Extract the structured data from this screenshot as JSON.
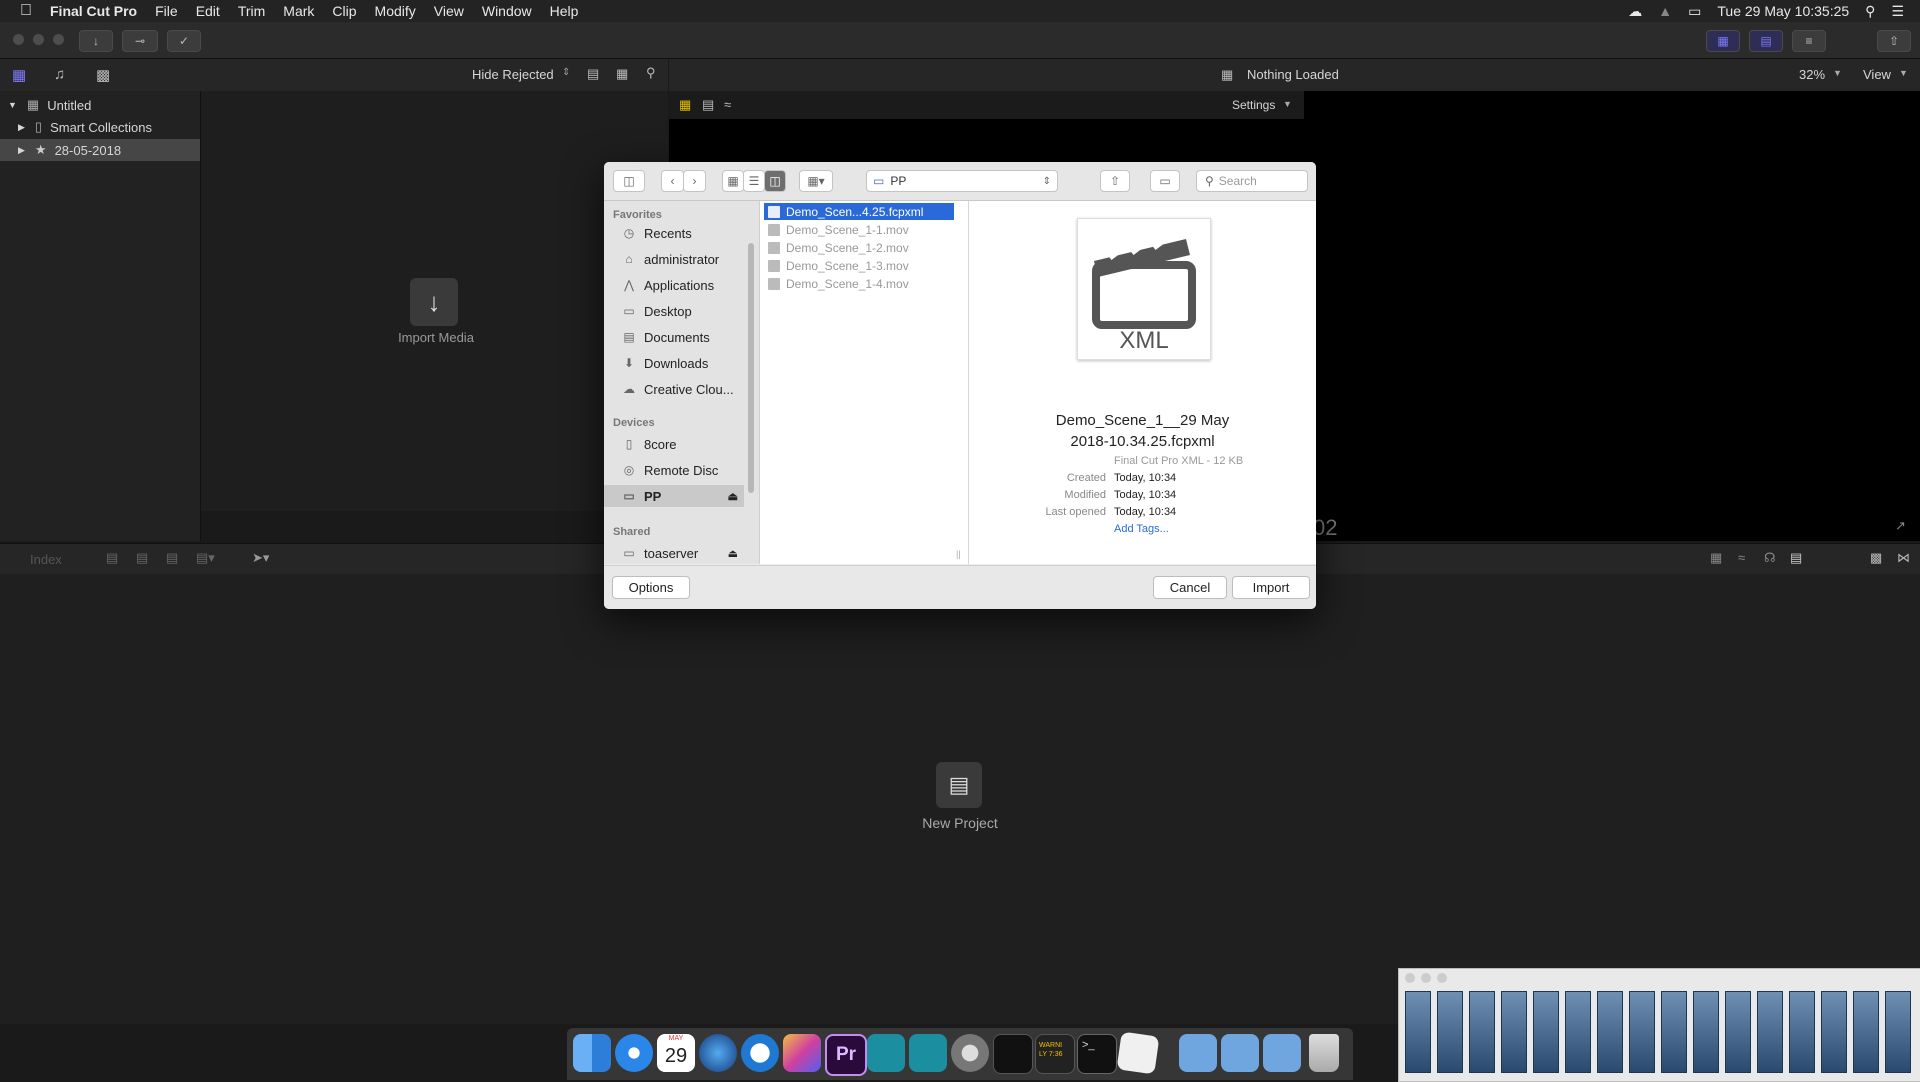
{
  "menubar": {
    "app_name": "Final Cut Pro",
    "menus": [
      "File",
      "Edit",
      "Trim",
      "Mark",
      "Clip",
      "Modify",
      "View",
      "Window",
      "Help"
    ],
    "clock": "Tue 29 May  10:35:25"
  },
  "libraries": {
    "filter_label": "Hide Rejected",
    "items": [
      {
        "label": "Untitled"
      },
      {
        "label": "Smart Collections"
      },
      {
        "label": "28-05-2018"
      }
    ],
    "import_label": "Import Media"
  },
  "viewer": {
    "status": "Nothing Loaded",
    "zoom": "32%",
    "view_menu": "View",
    "settings": "Settings",
    "timecode_fragment": "02"
  },
  "timeline": {
    "index_label": "Index",
    "new_project_label": "New Project"
  },
  "dialog": {
    "location": "PP",
    "search_placeholder": "Search",
    "sidebar": {
      "favorites_header": "Favorites",
      "favorites": [
        {
          "label": "Recents",
          "icon": "clock-icon"
        },
        {
          "label": "administrator",
          "icon": "home-icon"
        },
        {
          "label": "Applications",
          "icon": "applications-icon"
        },
        {
          "label": "Desktop",
          "icon": "desktop-icon"
        },
        {
          "label": "Documents",
          "icon": "documents-icon"
        },
        {
          "label": "Downloads",
          "icon": "downloads-icon"
        },
        {
          "label": "Creative Clou...",
          "icon": "creative-cloud-icon"
        }
      ],
      "devices_header": "Devices",
      "devices": [
        {
          "label": "8core",
          "icon": "drive-icon"
        },
        {
          "label": "Remote Disc",
          "icon": "disc-icon"
        },
        {
          "label": "PP",
          "icon": "drive-icon"
        }
      ],
      "shared_header": "Shared",
      "shared": [
        {
          "label": "toaserver",
          "icon": "server-icon"
        }
      ]
    },
    "files": [
      {
        "name": "Demo_Scen...4.25.fcpxml"
      },
      {
        "name": "Demo_Scene_1-1.mov"
      },
      {
        "name": "Demo_Scene_1-2.mov"
      },
      {
        "name": "Demo_Scene_1-3.mov"
      },
      {
        "name": "Demo_Scene_1-4.mov"
      }
    ],
    "preview": {
      "badge": "XML",
      "name_line1": "Demo_Scene_1__29 May",
      "name_line2": "2018-10.34.25.fcpxml",
      "kind": "Final Cut Pro XML - 12 KB",
      "created_label": "Created",
      "created_value": "Today, 10:34",
      "modified_label": "Modified",
      "modified_value": "Today, 10:34",
      "opened_label": "Last opened",
      "opened_value": "Today, 10:34",
      "add_tags": "Add Tags..."
    },
    "buttons": {
      "options": "Options",
      "cancel": "Cancel",
      "import": "Import"
    }
  },
  "dock": {
    "calendar_month": "MAY",
    "calendar_day": "29",
    "console_text": "WARNI\nLY 7:36"
  },
  "colors": {
    "accent": "#2a6ad8",
    "fcp_purple": "#5b4fe0"
  }
}
